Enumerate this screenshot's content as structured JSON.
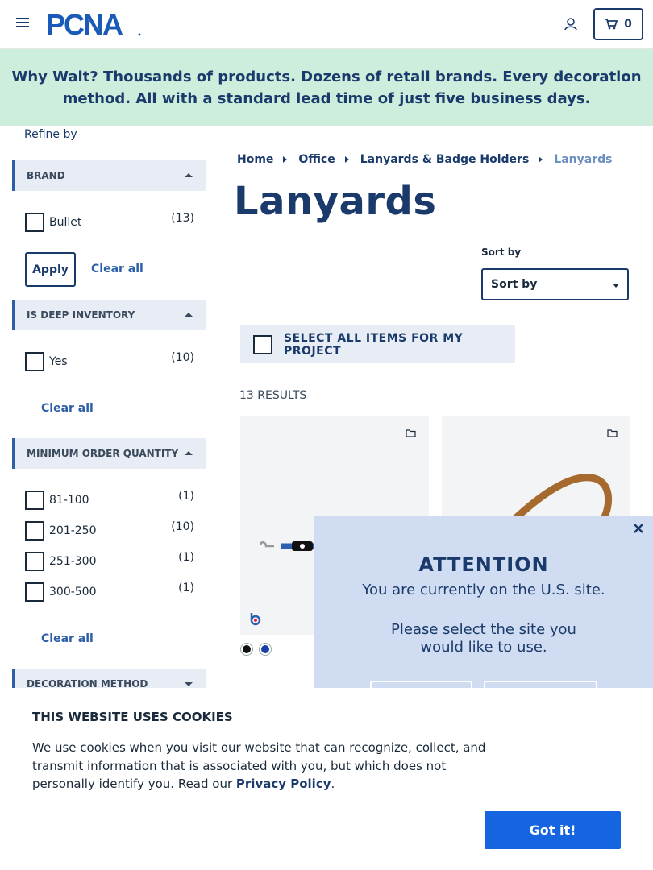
{
  "header": {
    "logo_text": "PCNA",
    "cart_count": "0",
    "icons": [
      "menu-icon",
      "user-icon",
      "cart-icon"
    ]
  },
  "promo": {
    "text_bold": "Why Wait?",
    "text": " Thousands of products. Dozens of retail brands. Every decoration method. All with a standard lead time of just five business days."
  },
  "sidebar": {
    "refine_label": "Refine by",
    "facets": [
      {
        "title": "BRAND",
        "expanded": true,
        "options": [
          {
            "label": "Bullet",
            "count": "(13)"
          }
        ],
        "apply_label": "Apply",
        "clear_label": "Clear all"
      },
      {
        "title": "IS DEEP INVENTORY",
        "expanded": true,
        "options": [
          {
            "label": "Yes",
            "count": "(10)"
          }
        ],
        "clear_label": "Clear all"
      },
      {
        "title": "MINIMUM ORDER QUANTITY",
        "expanded": true,
        "options": [
          {
            "label": "81-100",
            "count": "(1)"
          },
          {
            "label": "201-250",
            "count": "(10)"
          },
          {
            "label": "251-300",
            "count": "(1)"
          },
          {
            "label": "300-500",
            "count": "(1)"
          }
        ],
        "clear_label": "Clear all"
      },
      {
        "title": "DECORATION METHOD",
        "expanded": false
      }
    ]
  },
  "main": {
    "breadcrumb": [
      "Home",
      "Office",
      "Lanyards & Badge Holders",
      "Lanyards"
    ],
    "title": "Lanyards",
    "sort": {
      "label": "Sort by",
      "value": "Sort by"
    },
    "select_all_label": "SELECT ALL ITEMS FOR MY PROJECT",
    "results_label": "13 RESULTS",
    "products": [
      {
        "swatches": [
          "#111111",
          "#1a3fa8"
        ],
        "lanyard_color": "#2d5fb0"
      },
      {
        "lanyard_color": "#a66a2e"
      }
    ]
  },
  "modal": {
    "title": "ATTENTION",
    "line1": "You are currently on the U.S. site.",
    "line2a": "Please select the site you",
    "line2b": "would like to use."
  },
  "cookie": {
    "title": "THIS WEBSITE USES COOKIES",
    "text": "We use cookies when you visit our website that can recognize, collect, and transmit information that is associated with you, but which does not personally identify you. Read our ",
    "link": "Privacy Policy",
    "end": ".",
    "button": "Got it!"
  },
  "colors": {
    "brand_navy": "#1a3a6b",
    "accent_blue": "#1565e0",
    "promo_bg": "#cdeedd",
    "facet_bg": "#e8edf5",
    "modal_bg": "#cfdcf1"
  }
}
